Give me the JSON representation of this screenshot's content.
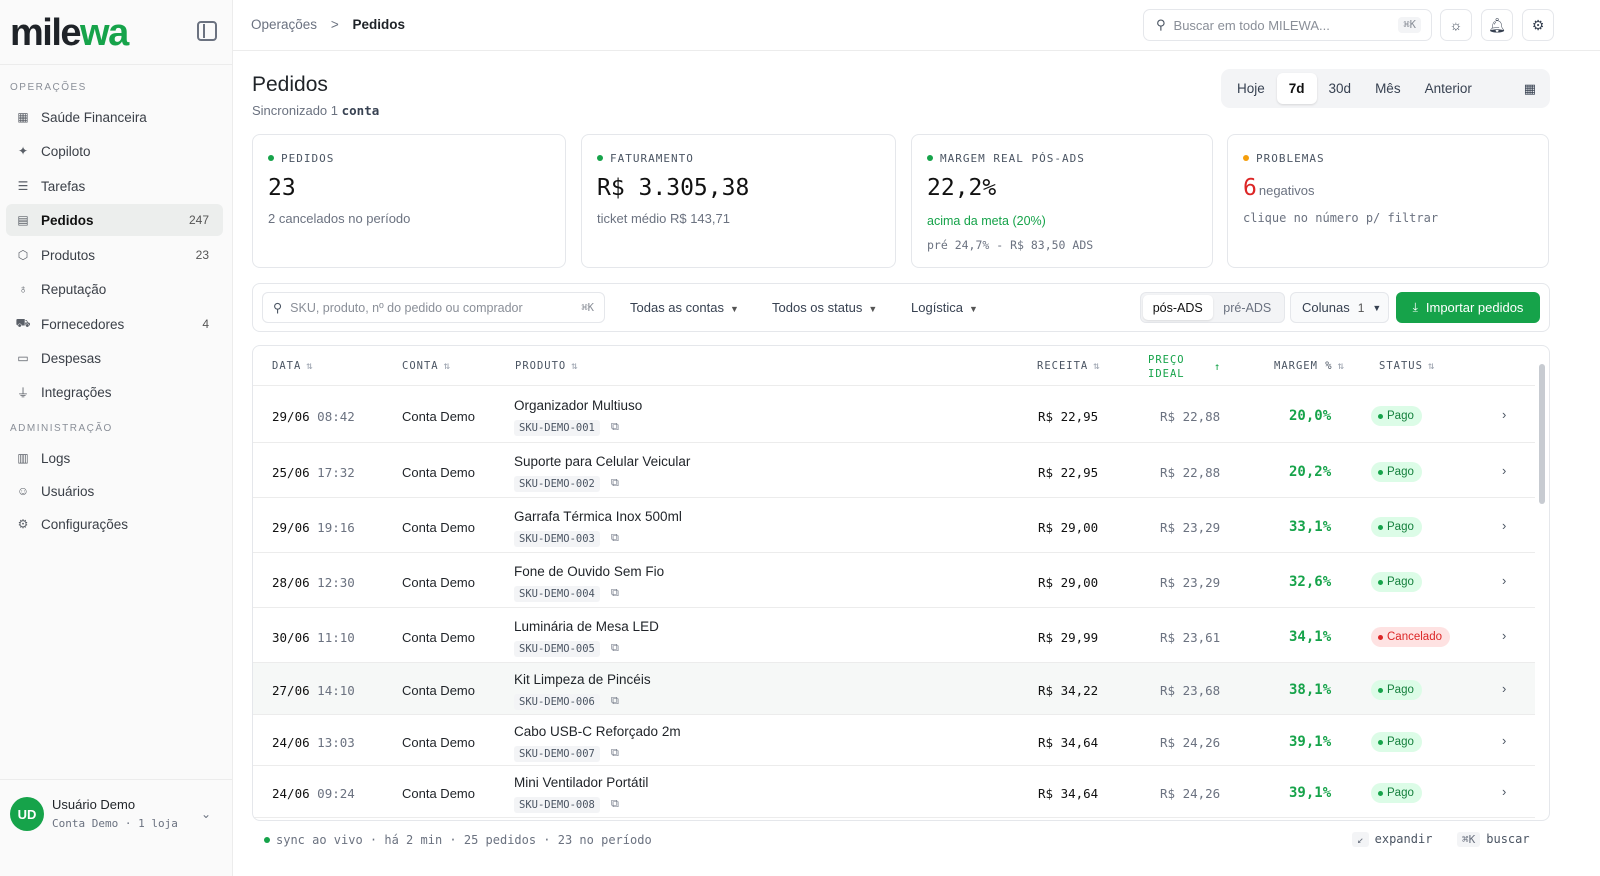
{
  "brand": {
    "prefix": "mile",
    "accent": "wa"
  },
  "sidebar": {
    "section_ops": "OPERAÇÕES",
    "section_admin": "ADMINISTRAÇÃO",
    "items": [
      {
        "label": "Saúde Financeira",
        "icon": "grid-icon",
        "count": ""
      },
      {
        "label": "Copiloto",
        "icon": "sparkle-icon",
        "count": ""
      },
      {
        "label": "Tarefas",
        "icon": "checklist-icon",
        "count": ""
      },
      {
        "label": "Pedidos",
        "icon": "receipt-icon",
        "count": "247"
      },
      {
        "label": "Produtos",
        "icon": "package-icon",
        "count": "23"
      },
      {
        "label": "Reputação",
        "icon": "award-icon",
        "count": ""
      },
      {
        "label": "Fornecedores",
        "icon": "truck-icon",
        "count": "4"
      },
      {
        "label": "Despesas",
        "icon": "wallet-icon",
        "count": ""
      },
      {
        "label": "Integrações",
        "icon": "plug-icon",
        "count": ""
      }
    ],
    "admin_items": [
      {
        "label": "Logs",
        "icon": "clipboard-icon"
      },
      {
        "label": "Usuários",
        "icon": "users-icon"
      },
      {
        "label": "Configurações",
        "icon": "gear-icon"
      }
    ],
    "user": {
      "initials": "UD",
      "name": "Usuário Demo",
      "sub": "Conta Demo · 1 loja"
    }
  },
  "topbar": {
    "crumb_parent": "Operações",
    "crumb_sep": ">",
    "crumb_current": "Pedidos",
    "search_placeholder": "Buscar em todo MILEWA...",
    "search_kbd": "⌘K"
  },
  "page": {
    "title": "Pedidos",
    "sub_prefix": "Sincronizado 1",
    "sub_bold": "conta",
    "periods": [
      "Hoje",
      "7d",
      "30d",
      "Mês",
      "Anterior"
    ],
    "selected_period": "7d"
  },
  "kpis": {
    "pedidos": {
      "label": "PEDIDOS",
      "value": "23",
      "sub": "2 cancelados no período",
      "dot": "#16a34a"
    },
    "faturamento": {
      "label": "FATURAMENTO",
      "value": "R$ 3.305,38",
      "sub": "ticket médio R$ 143,71",
      "dot": "#16a34a"
    },
    "margem": {
      "label": "MARGEM REAL PÓS-ADS",
      "value": "22,2%",
      "green": "acima da meta (20%)",
      "sub": "pré 24,7% - R$ 83,50 ADS",
      "dot": "#16a34a"
    },
    "problemas": {
      "label": "PROBLEMAS",
      "big": "6",
      "value_suffix": "negativos",
      "sub": "clique no número p/ filtrar",
      "dot": "#f59e0b"
    }
  },
  "filters": {
    "search_placeholder": "SKU, produto, nº do pedido ou comprador",
    "search_kbd": "⌘K",
    "accounts": "Todas as contas",
    "status": "Todos os status",
    "logistics": "Logística",
    "ads_options": [
      "pós-ADS",
      "pré-ADS"
    ],
    "ads_selected": "pós-ADS",
    "columns_label": "Colunas",
    "columns_count": "1",
    "import_label": "Importar pedidos"
  },
  "table": {
    "headers": {
      "data": "DATA",
      "conta": "CONTA",
      "produto": "PRODUTO",
      "receita": "RECEITA",
      "preco_ideal_1": "PREÇO",
      "preco_ideal_2": "IDEAL",
      "margem": "MARGEM %",
      "status": "STATUS"
    },
    "rows": [
      {
        "date": "29/06",
        "time": "08:42",
        "conta": "Conta Demo",
        "produto": "Organizador Multiuso",
        "sku": "SKU-DEMO-001",
        "receita": "R$ 22,95",
        "ideal": "R$ 22,88",
        "margem": "20,0%",
        "status": "Pago"
      },
      {
        "date": "25/06",
        "time": "17:32",
        "conta": "Conta Demo",
        "produto": "Suporte para Celular Veicular",
        "sku": "SKU-DEMO-002",
        "receita": "R$ 22,95",
        "ideal": "R$ 22,88",
        "margem": "20,2%",
        "status": "Pago"
      },
      {
        "date": "29/06",
        "time": "19:16",
        "conta": "Conta Demo",
        "produto": "Garrafa Térmica Inox 500ml",
        "sku": "SKU-DEMO-003",
        "receita": "R$ 29,00",
        "ideal": "R$ 23,29",
        "margem": "33,1%",
        "status": "Pago"
      },
      {
        "date": "28/06",
        "time": "12:30",
        "conta": "Conta Demo",
        "produto": "Fone de Ouvido Sem Fio",
        "sku": "SKU-DEMO-004",
        "receita": "R$ 29,00",
        "ideal": "R$ 23,29",
        "margem": "32,6%",
        "status": "Pago"
      },
      {
        "date": "30/06",
        "time": "11:10",
        "conta": "Conta Demo",
        "produto": "Luminária de Mesa LED",
        "sku": "SKU-DEMO-005",
        "receita": "R$ 29,99",
        "ideal": "R$ 23,61",
        "margem": "34,1%",
        "status": "Cancelado"
      },
      {
        "date": "27/06",
        "time": "14:10",
        "conta": "Conta Demo",
        "produto": "Kit Limpeza de Pincéis",
        "sku": "SKU-DEMO-006",
        "receita": "R$ 34,22",
        "ideal": "R$ 23,68",
        "margem": "38,1%",
        "status": "Pago"
      },
      {
        "date": "24/06",
        "time": "13:03",
        "conta": "Conta Demo",
        "produto": "Cabo USB-C Reforçado 2m",
        "sku": "SKU-DEMO-007",
        "receita": "R$ 34,64",
        "ideal": "R$ 24,26",
        "margem": "39,1%",
        "status": "Pago"
      },
      {
        "date": "24/06",
        "time": "09:24",
        "conta": "Conta Demo",
        "produto": "Mini Ventilador Portátil",
        "sku": "SKU-DEMO-008",
        "receita": "R$ 34,64",
        "ideal": "R$ 24,26",
        "margem": "39,1%",
        "status": "Pago"
      }
    ]
  },
  "footer": {
    "status": "sync ao vivo · há 2 min · 25 pedidos · 23 no período",
    "expand_key": "↙",
    "expand_label": "expandir",
    "search_key": "⌘K",
    "search_label": "buscar"
  },
  "colors": {
    "accent": "#16a34a",
    "danger": "#dc2626",
    "warning": "#f59e0b"
  }
}
